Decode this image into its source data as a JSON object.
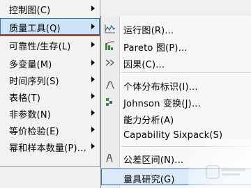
{
  "left_menu": {
    "items": [
      {
        "label": "控制图(C)",
        "arrow": true,
        "selected": false
      },
      {
        "label": "质量工具(Q)",
        "arrow": true,
        "selected": true
      },
      {
        "label": "可靠性/生存(L)",
        "arrow": true,
        "selected": false
      },
      {
        "label": "多变量(M)",
        "arrow": true,
        "selected": false
      },
      {
        "label": "时间序列(S)",
        "arrow": true,
        "selected": false
      },
      {
        "label": "表格(T)",
        "arrow": true,
        "selected": false
      },
      {
        "label": "非参数(N)",
        "arrow": true,
        "selected": false
      },
      {
        "label": "等价检验(E)",
        "arrow": true,
        "selected": false
      },
      {
        "label": "幂和样本数量(P)...",
        "arrow": true,
        "selected": false
      }
    ]
  },
  "right_menu": {
    "items": [
      {
        "label": "运行图(R)...",
        "icon": "run-chart-icon"
      },
      {
        "label": "Pareto 图(P)...",
        "icon": "pareto-chart-icon"
      },
      {
        "label": "因果(C)...",
        "icon": "cause-effect-icon"
      },
      {
        "label": "个体分布标识(I)...",
        "icon": "distribution-id-icon"
      },
      {
        "label": "Johnson 变换(J)...",
        "icon": "johnson-transform-icon"
      },
      {
        "label": "能力分析(A)",
        "icon": ""
      },
      {
        "label": "Capability Sixpack(S)",
        "icon": ""
      },
      {
        "label": "公差区间(N)...",
        "icon": "tolerance-interval-icon"
      },
      {
        "label": "量具研究(G)",
        "icon": "gage-study-icon"
      }
    ]
  },
  "colors": {
    "selection_border": "#2f6fc2",
    "selection_fill": "#cfe3f8",
    "annotation_red": "#c0392b"
  }
}
